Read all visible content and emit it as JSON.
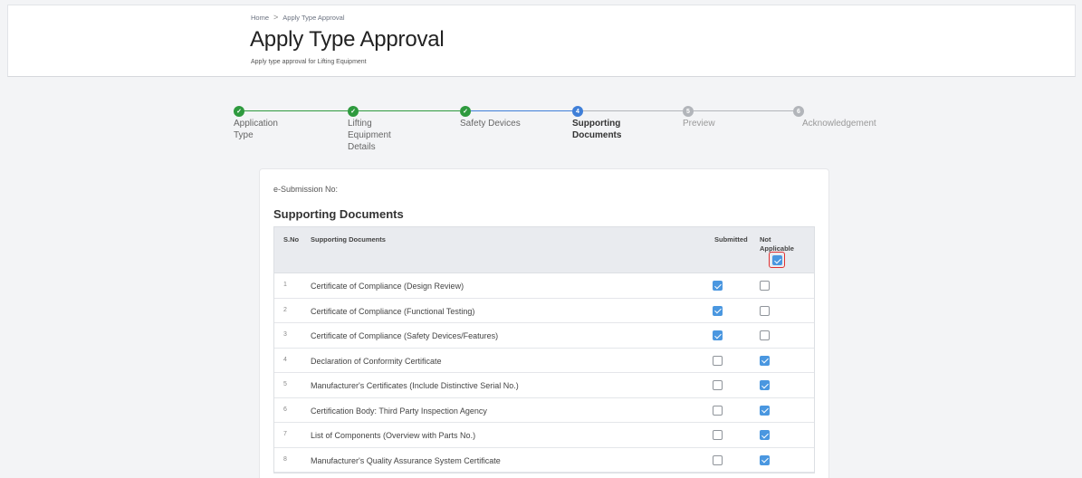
{
  "breadcrumb": {
    "home": "Home",
    "separator": ">",
    "current": "Apply Type Approval"
  },
  "page": {
    "title": "Apply Type Approval",
    "subtitle": "Apply type approval for Lifting Equipment"
  },
  "steps": [
    {
      "label_lines": [
        "Application",
        "Type"
      ],
      "status": "done",
      "marker": "check"
    },
    {
      "label_lines": [
        "Lifting",
        "Equipment",
        "Details"
      ],
      "status": "done",
      "marker": "check"
    },
    {
      "label_lines": [
        "Safety Devices"
      ],
      "status": "done",
      "marker": "check"
    },
    {
      "label_lines": [
        "Supporting",
        "Documents"
      ],
      "status": "active",
      "marker": "4"
    },
    {
      "label_lines": [
        "Preview"
      ],
      "status": "todo",
      "marker": "5"
    },
    {
      "label_lines": [
        "Acknowledgement"
      ],
      "status": "todo",
      "marker": "6"
    }
  ],
  "form": {
    "esubmission_label": "e-Submission No:",
    "section_title": "Supporting Documents",
    "headers": {
      "sno": "S.No",
      "doc": "Supporting Documents",
      "submitted": "Submitted",
      "not_applicable": "Not Applicable"
    },
    "header_not_applicable_checked": true,
    "rows": [
      {
        "no": "1",
        "doc": "Certificate of Compliance (Design Review)",
        "submitted": true,
        "not_applicable": false
      },
      {
        "no": "2",
        "doc": "Certificate of Compliance (Functional Testing)",
        "submitted": true,
        "not_applicable": false
      },
      {
        "no": "3",
        "doc": "Certificate of Compliance (Safety Devices/Features)",
        "submitted": true,
        "not_applicable": false
      },
      {
        "no": "4",
        "doc": "Declaration of Conformity Certificate",
        "submitted": false,
        "not_applicable": true
      },
      {
        "no": "5",
        "doc": "Manufacturer's Certificates (Include Distinctive Serial No.)",
        "submitted": false,
        "not_applicable": true
      },
      {
        "no": "6",
        "doc": "Certification Body: Third Party Inspection Agency",
        "submitted": false,
        "not_applicable": true
      },
      {
        "no": "7",
        "doc": "List of Components (Overview with Parts No.)",
        "submitted": false,
        "not_applicable": true
      },
      {
        "no": "8",
        "doc": "Manufacturer's Quality Assurance System Certificate",
        "submitted": false,
        "not_applicable": true
      }
    ]
  },
  "colors": {
    "done": "#2e9a3e",
    "active": "#3f7fd8",
    "todo": "#b2b5ba",
    "checkbox": "#4a97e0",
    "highlight": "#e03131"
  }
}
